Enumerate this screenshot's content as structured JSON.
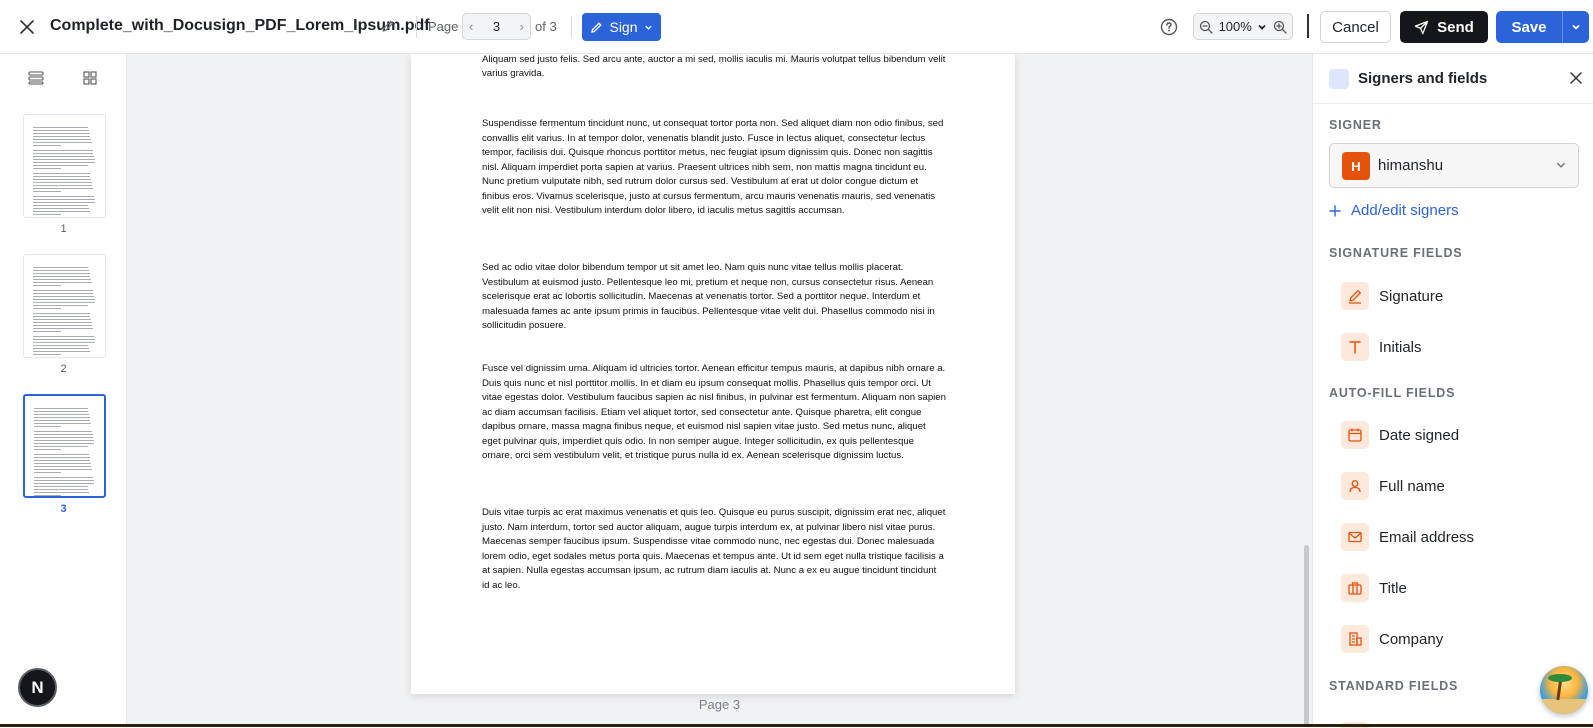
{
  "topbar": {
    "document_title": "Complete_with_Docusign_PDF_Lorem_Ipsum.pdf",
    "page_label": "Page",
    "current_page": "3",
    "of_label": "of 3",
    "sign_label": "Sign",
    "zoom_value": "100%",
    "cancel_label": "Cancel",
    "send_label": "Send",
    "save_label": "Save"
  },
  "thumbnails": {
    "pages": [
      {
        "number": "1"
      },
      {
        "number": "2"
      },
      {
        "number": "3"
      }
    ],
    "active_page": "3"
  },
  "document": {
    "paragraphs": [
      "Pellentesque sed finibus massa. Nullam diam sem, porttitor vel sem sed, scelerisque molestie lorem. Aliquam sed justo felis. Sed arcu ante, auctor a mi sed, mollis iaculis mi. Mauris volutpat tellus bibendum velit varius gravida.",
      "Suspendisse fermentum tincidunt nunc, ut consequat tortor porta non. Sed aliquet diam non odio finibus, sed convallis elit varius. In at tempor dolor, venenatis blandit justo. Fusce in lectus aliquet, consectetur lectus tempor, facilisis dui. Quisque rhoncus porttitor metus, nec feugiat ipsum dignissim quis. Donec non sagittis nisl. Aliquam imperdiet porta sapien at varius. Praesent ultrices nibh sem, non mattis magna tincidunt eu. Nunc pretium vulputate nibh, sed rutrum dolor cursus sed. Vestibulum at erat ut dolor congue dictum et finibus eros. Vivamus scelerisque, justo at cursus fermentum, arcu mauris venenatis mauris, sed venenatis velit elit non nisi. Vestibulum interdum dolor libero, id iaculis metus sagittis accumsan.",
      "Sed ac odio vitae dolor bibendum tempor ut sit amet leo. Nam quis nunc vitae tellus mollis placerat. Vestibulum at euismod justo. Pellentesque leo mi, pretium et neque non, cursus consectetur risus. Aenean scelerisque erat ac lobortis sollicitudin. Maecenas at venenatis tortor. Sed a porttitor neque. Interdum et malesuada fames ac ante ipsum primis in faucibus. Pellentesque vitae velit dui. Phasellus commodo nisi in sollicitudin posuere.",
      "Fusce vel dignissim urna. Aliquam id ultricies tortor. Aenean efficitur tempus mauris, at dapibus nibh ornare a. Duis quis nunc et nisl porttitor mollis. In et diam eu ipsum consequat mollis. Phasellus quis tempor orci. Ut vitae egestas dolor. Vestibulum faucibus sapien ac nisl finibus, in pulvinar est fermentum. Aliquam non sapien ac diam accumsan facilisis. Etiam vel aliquet tortor, sed consectetur ante. Quisque pharetra, elit congue dapibus ornare, massa magna finibus neque, et euismod nisl sapien vitae justo. Sed metus nunc, aliquet eget pulvinar quis, imperdiet quis odio. In non semper augue. Integer sollicitudin, ex quis pellentesque ornare, orci sem vestibulum velit, et tristique purus nulla id ex. Aenean scelerisque dignissim luctus.",
      "Duis vitae turpis ac erat maximus venenatis et quis leo. Quisque eu purus suscipit, dignissim erat nec, aliquet justo. Nam interdum, tortor sed auctor aliquam, augue turpis interdum ex, at pulvinar libero nisl vitae purus. Maecenas semper faucibus ipsum. Suspendisse vitae commodo nunc, nec egestas dui. Donec malesuada lorem odio, eget sodales metus porta quis. Maecenas et tempus ante. Ut id sem eget nulla tristique facilisis a at sapien. Nulla egestas accumsan ipsum, ac rutrum diam iaculis at. Nunc a ex eu augue tincidunt tincidunt id ac leo."
    ],
    "page_footer": "Page 3"
  },
  "panel": {
    "title": "Signers and fields",
    "signer_section": "SIGNER",
    "signer_initial": "H",
    "signer_name": "himanshu",
    "add_signers_label": "Add/edit signers",
    "signature_section": "SIGNATURE FIELDS",
    "signature_fields": [
      {
        "label": "Signature",
        "icon": "pen-icon"
      },
      {
        "label": "Initials",
        "icon": "text-t-icon"
      }
    ],
    "autofill_section": "AUTO-FILL FIELDS",
    "autofill_fields": [
      {
        "label": "Date signed",
        "icon": "calendar-icon"
      },
      {
        "label": "Full name",
        "icon": "person-icon"
      },
      {
        "label": "Email address",
        "icon": "envelope-icon"
      },
      {
        "label": "Title",
        "icon": "briefcase-icon"
      },
      {
        "label": "Company",
        "icon": "building-icon"
      }
    ],
    "standard_section": "STANDARD FIELDS"
  },
  "floating": {
    "n_label": "N"
  },
  "colors": {
    "accent": "#2b63d9",
    "field_icon": "#e4520b",
    "field_icon_bg": "#fde9dc",
    "avatar": "#e4520b",
    "send": "#14161a"
  }
}
